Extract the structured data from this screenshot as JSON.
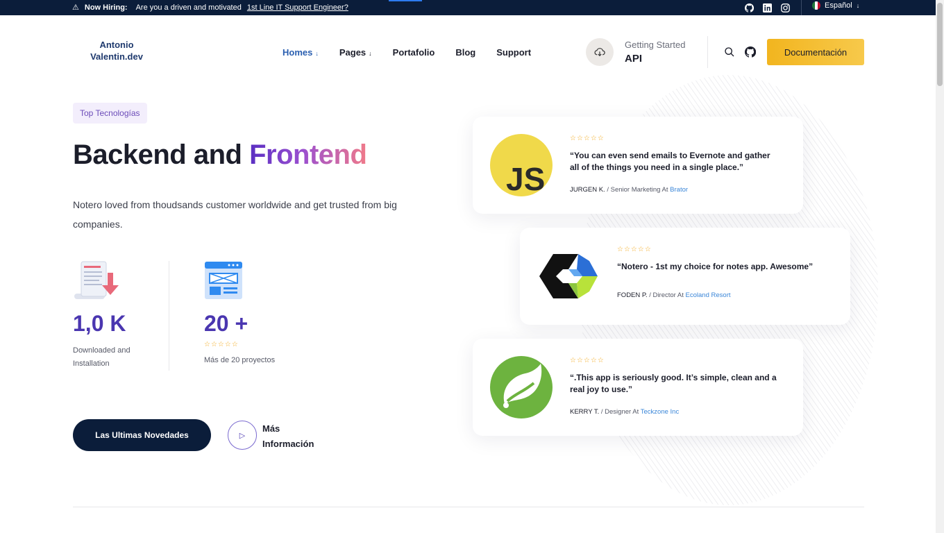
{
  "topbar": {
    "hiring_label": "Now Hiring:",
    "hiring_text": "Are you a driven and motivated",
    "hiring_link": "1st Line IT Support Engineer?",
    "language": "Español",
    "socials": [
      "github-icon",
      "linkedin-icon",
      "instagram-icon"
    ]
  },
  "header": {
    "logo_line1": "Antonio",
    "logo_line2": "Valentin.dev",
    "nav": [
      {
        "label": "Homes",
        "active": true,
        "dropdown": true
      },
      {
        "label": "Pages",
        "active": false,
        "dropdown": true
      },
      {
        "label": "Portafolio",
        "active": false,
        "dropdown": false
      },
      {
        "label": "Blog",
        "active": false,
        "dropdown": false
      },
      {
        "label": "Support",
        "active": false,
        "dropdown": false
      }
    ],
    "getting_started": "Getting Started",
    "api": "API",
    "doc_button": "Documentación"
  },
  "hero": {
    "pill": "Top Tecnologías",
    "title_plain": "Backend and",
    "title_gradient": "Frontend",
    "description": "Notero loved from thoudsands customer worldwide and get trusted from big companies.",
    "stat1": {
      "value": "1,0 K",
      "label": "Downloaded and Installation"
    },
    "stat2": {
      "value": "20 +",
      "stars": "☆☆☆☆☆",
      "label": "Más de 20 proyectos"
    },
    "primary_button": "Las Ultimas Novedades",
    "secondary_link": "Más Información"
  },
  "testimonials": [
    {
      "logo": "javascript-logo",
      "stars": "☆☆☆☆☆",
      "quote": "“You can even send emails to Evernote and gather all of the things you need in a single place.”",
      "name": "JURGEN K.",
      "role": " / Senior Marketing At ",
      "company": "Brator"
    },
    {
      "logo": "eclipse-che-logo",
      "stars": "☆☆☆☆☆",
      "quote": "“Notero - 1st my choice for notes app. Awesome”",
      "name": "FODEN P.",
      "role": " / Director At ",
      "company": "Ecoland Resort"
    },
    {
      "logo": "spring-logo",
      "stars": "☆☆☆☆☆",
      "quote": "“.This app is seriously good. It’s simple, clean and a real joy to use.”",
      "name": "KERRY T.",
      "role": " / Designer At ",
      "company": "Teckzone Inc"
    }
  ],
  "colors": {
    "topbar_bg": "#0b1d3a",
    "accent_purple": "#4a36b0",
    "doc_button": "#f2b51f",
    "link_blue": "#3a86d8",
    "star": "#f2a81a"
  }
}
